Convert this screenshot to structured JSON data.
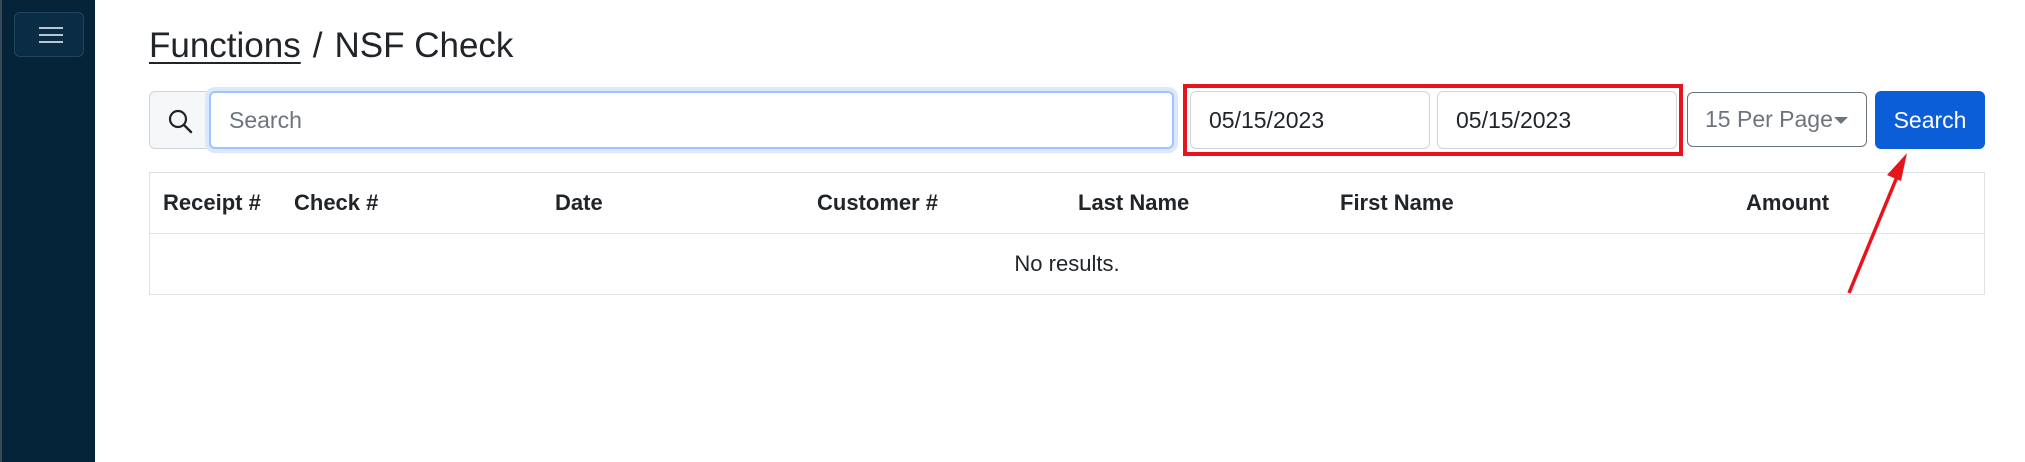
{
  "sidebar": {
    "menu_icon": "hamburger-menu-icon"
  },
  "breadcrumb": {
    "link": "Functions",
    "separator": "/",
    "current": "NSF Check"
  },
  "search": {
    "placeholder": "Search",
    "value": "",
    "icon": "search-icon"
  },
  "date_range": {
    "from": "05/15/2023",
    "to": "05/15/2023"
  },
  "per_page": {
    "label": "15 Per Page"
  },
  "search_button": {
    "label": "Search"
  },
  "table": {
    "columns": [
      "Receipt #",
      "Check #",
      "Date",
      "Customer #",
      "Last Name",
      "First Name",
      "Amount"
    ],
    "empty_text": "No results."
  },
  "annotations": {
    "highlight_color": "#e8141c",
    "arrow_color": "#e8141c"
  },
  "colors": {
    "sidebar": "#05243a",
    "primary": "#0b5ed7"
  }
}
